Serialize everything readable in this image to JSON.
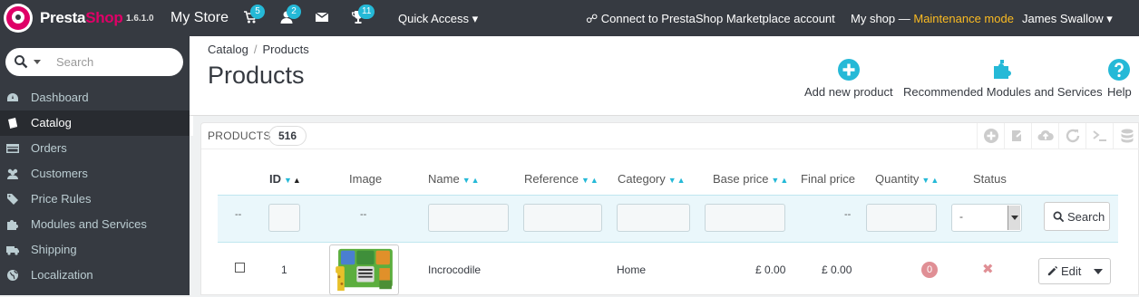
{
  "topbar": {
    "brand_part1": "Presta",
    "brand_part2": "Shop",
    "version": "1.6.1.0",
    "store_name": "My Store",
    "orders_count": "5",
    "customers_count": "2",
    "notifications_count": "11",
    "quick_access": "Quick Access ▾",
    "marketplace": "Connect to PrestaShop Marketplace account",
    "shop_label": "My shop — ",
    "maintenance": "Maintenance mode",
    "user": "James Swallow ▾"
  },
  "sidebar": {
    "search_placeholder": "Search",
    "items": [
      {
        "label": "Dashboard",
        "icon": "dashboard-icon"
      },
      {
        "label": "Catalog",
        "icon": "book-icon"
      },
      {
        "label": "Orders",
        "icon": "credit-card-icon"
      },
      {
        "label": "Customers",
        "icon": "users-icon"
      },
      {
        "label": "Price Rules",
        "icon": "tags-icon"
      },
      {
        "label": "Modules and Services",
        "icon": "puzzle-icon"
      },
      {
        "label": "Shipping",
        "icon": "truck-icon"
      },
      {
        "label": "Localization",
        "icon": "globe-icon"
      }
    ]
  },
  "header": {
    "breadcrumb_1": "Catalog",
    "breadcrumb_sep": "/",
    "breadcrumb_2": "Products",
    "title": "Products",
    "add_product": "Add new product",
    "recommended": "Recommended Modules and Services",
    "help": "Help"
  },
  "panel": {
    "title": "PRODUCTS",
    "count": "516"
  },
  "table": {
    "headers": {
      "id": "ID",
      "image": "Image",
      "name": "Name",
      "reference": "Reference",
      "category": "Category",
      "base_price": "Base price",
      "final_price": "Final price",
      "quantity": "Quantity",
      "status": "Status"
    },
    "filter": {
      "dots": "--",
      "status_value": "-",
      "search_button": "Search"
    },
    "rows": [
      {
        "id": "1",
        "name": "Incrocodile",
        "category": "Home",
        "base_price": "£ 0.00",
        "final_price": "£ 0.00",
        "quantity": "0",
        "status": "✖",
        "edit": "Edit"
      }
    ]
  },
  "colors": {
    "topbar": "#363a41",
    "accent": "#25b9d7",
    "brand_pink": "#df0067",
    "maintenance": "#fbbb22",
    "disabled": "#e08f95"
  }
}
